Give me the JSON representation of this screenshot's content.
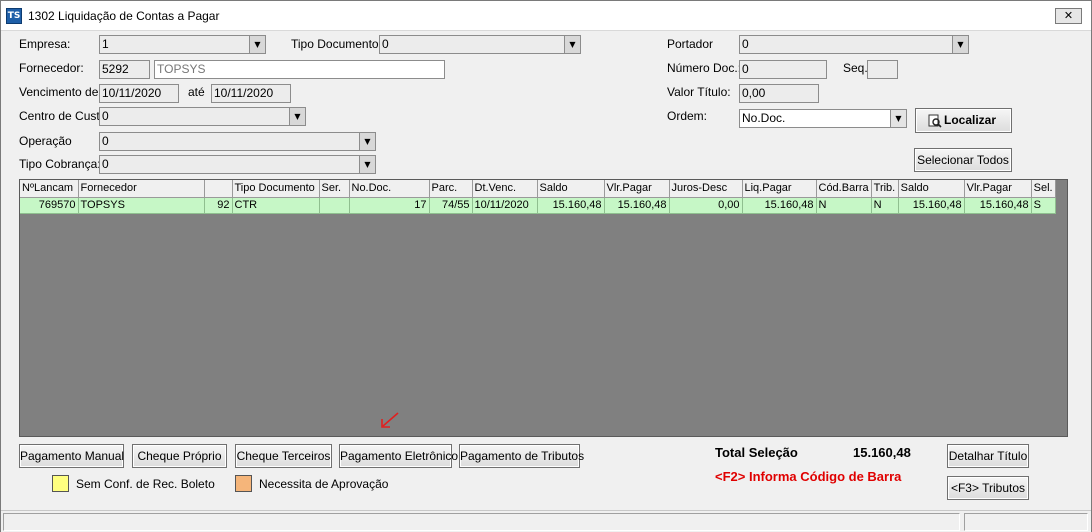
{
  "window": {
    "title": "1302 Liquidação de Contas a Pagar",
    "icon_text": "TS",
    "close_glyph": "✕"
  },
  "form": {
    "empresa": {
      "label": "Empresa:",
      "value": "1"
    },
    "tipo_documento": {
      "label": "Tipo Documento",
      "value": "0"
    },
    "portador": {
      "label": "Portador",
      "value": "0"
    },
    "fornecedor": {
      "label": "Fornecedor:",
      "code": "5292",
      "name": "TOPSYS"
    },
    "numero_doc": {
      "label": "Número Doc.:",
      "value": "0"
    },
    "seq": {
      "label": "Seq.",
      "value": ""
    },
    "vencimento": {
      "label": "Vencimento de:",
      "from": "10/11/2020",
      "to_label": "até",
      "to": "10/11/2020"
    },
    "valor_titulo": {
      "label": "Valor Título:",
      "value": "0,00"
    },
    "centro_custo": {
      "label": "Centro de Custo:",
      "value": "0"
    },
    "ordem": {
      "label": "Ordem:",
      "value": "No.Doc."
    },
    "operacao": {
      "label": "Operação",
      "value": "0"
    },
    "tipo_cobranca": {
      "label": "Tipo Cobrança:",
      "value": "0"
    },
    "localizar_label": "Localizar",
    "selecionar_todos_label": "Selecionar Todos"
  },
  "grid": {
    "columns": [
      "NºLancam",
      "Fornecedor",
      "",
      "Tipo Documento",
      "Ser.",
      "No.Doc.",
      "Parc.",
      "Dt.Venc.",
      "Saldo",
      "Vlr.Pagar",
      "Juros-Desc",
      "Liq.Pagar",
      "Cód.Barra",
      "Trib.",
      "Saldo",
      "Vlr.Pagar",
      "Sel."
    ],
    "rows": [
      [
        "769570",
        "TOPSYS",
        "92",
        "CTR",
        "",
        "17",
        "74/55",
        "10/11/2020",
        "15.160,48",
        "15.160,48",
        "0,00",
        "15.160,48",
        "N",
        "N",
        "15.160,48",
        "15.160,48",
        "S"
      ]
    ]
  },
  "buttons": {
    "pagamento_manual": "Pagamento Manual",
    "cheque_proprio": "Cheque Próprio",
    "cheque_terceiros": "Cheque Terceiros",
    "pagamento_eletronico": "Pagamento Eletrônico",
    "pagamento_tributos": "Pagamento de Tributos",
    "detalhar_titulo": "Detalhar Título",
    "f3_tributos": "<F3> Tributos"
  },
  "legend": {
    "sem_conf": {
      "label": "Sem Conf. de Rec. Boleto",
      "color": "#ffff80"
    },
    "necessita": {
      "label": "Necessita de Aprovação",
      "color": "#f5b57a"
    }
  },
  "totals": {
    "label": "Total Seleção",
    "value": "15.160,48",
    "f2_hint": "<F2> Informa Código de Barra"
  },
  "colors": {
    "row_highlight": "#c6f7c6",
    "grid_background": "#808080",
    "f2_hint": "#e00000",
    "annotation_arrow": "#e02020"
  }
}
